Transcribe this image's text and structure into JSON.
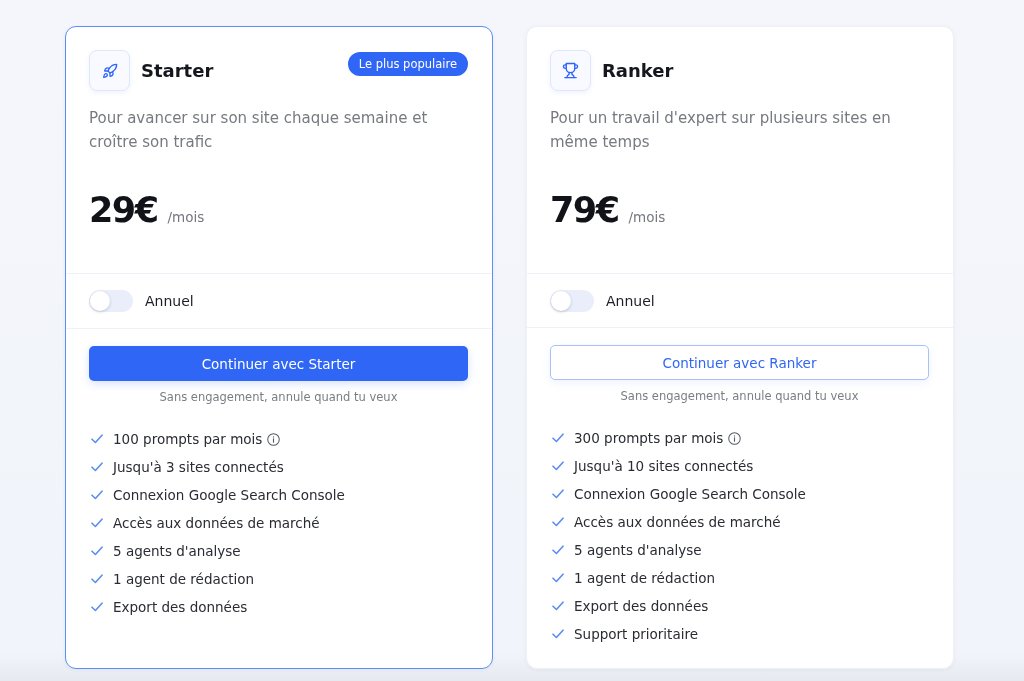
{
  "plans": [
    {
      "name": "Starter",
      "badge": "Le plus populaire",
      "featured": true,
      "description": "Pour avancer sur son site chaque semaine et croître son trafic",
      "price": "29€",
      "period": "/mois",
      "annual_toggle": {
        "label": "Annuel",
        "on": false
      },
      "button": "Continuer avec Starter",
      "note": "Sans engagement, annule quand tu veux",
      "features": [
        {
          "text": "100 prompts par mois",
          "info": true
        },
        {
          "text": "Jusqu'à 3 sites connectés",
          "info": false
        },
        {
          "text": "Connexion Google Search Console",
          "info": false
        },
        {
          "text": "Accès aux données de marché",
          "info": false
        },
        {
          "text": "5 agents d'analyse",
          "info": false
        },
        {
          "text": "1 agent de rédaction",
          "info": false
        },
        {
          "text": "Export des données",
          "info": false
        }
      ]
    },
    {
      "name": "Ranker",
      "featured": false,
      "description": "Pour un travail d'expert sur plusieurs sites en même temps",
      "price": "79€",
      "period": "/mois",
      "annual_toggle": {
        "label": "Annuel",
        "on": false
      },
      "button": "Continuer avec Ranker",
      "note": "Sans engagement, annule quand tu veux",
      "features": [
        {
          "text": "300 prompts par mois",
          "info": true
        },
        {
          "text": "Jusqu'à 10 sites connectés",
          "info": false
        },
        {
          "text": "Connexion Google Search Console",
          "info": false
        },
        {
          "text": "Accès aux données de marché",
          "info": false
        },
        {
          "text": "5 agents d'analyse",
          "info": false
        },
        {
          "text": "1 agent de rédaction",
          "info": false
        },
        {
          "text": "Export des données",
          "info": false
        },
        {
          "text": "Support prioritaire",
          "info": false
        }
      ]
    }
  ]
}
